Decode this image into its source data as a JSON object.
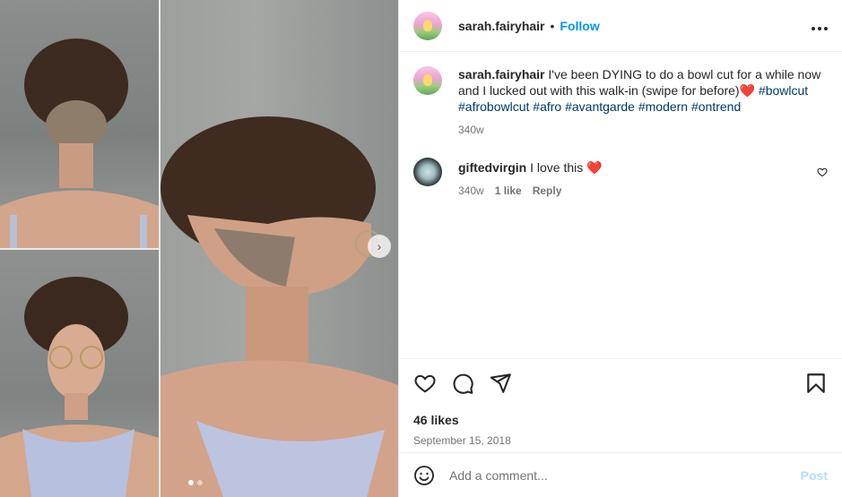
{
  "post": {
    "username": "sarah.fairyhair",
    "separator": "•",
    "follow_label": "Follow",
    "more_label": "•••",
    "image_count": 2,
    "current_image_index": 1
  },
  "comments": [
    {
      "username": "sarah.fairyhair",
      "text_before": "I've been DYING to do a bowl cut for a while now and I lucked out with this walk-in (swipe for before)",
      "emoji": "❤️",
      "hashtags": [
        "#bowlcut",
        "#afrobowlcut",
        "#afro",
        "#avantgarde",
        "#modern",
        "#ontrend"
      ],
      "time": "340w"
    },
    {
      "username": "giftedvirgin",
      "text": "I love this",
      "emoji": "❤️",
      "time": "340w",
      "likes": "1 like",
      "reply_label": "Reply"
    }
  ],
  "actions": {
    "like_icon": "heart-outline-icon",
    "comment_icon": "comment-bubble-icon",
    "share_icon": "paper-plane-icon",
    "save_icon": "bookmark-icon"
  },
  "likes": "46 likes",
  "date": "September 15, 2018",
  "composer": {
    "placeholder": "Add a comment...",
    "post_label": "Post"
  },
  "colors": {
    "accent": "#0095f6",
    "hashtag": "#00376b",
    "heart_red": "#ed4956",
    "post_disabled": "#b2dffc"
  }
}
